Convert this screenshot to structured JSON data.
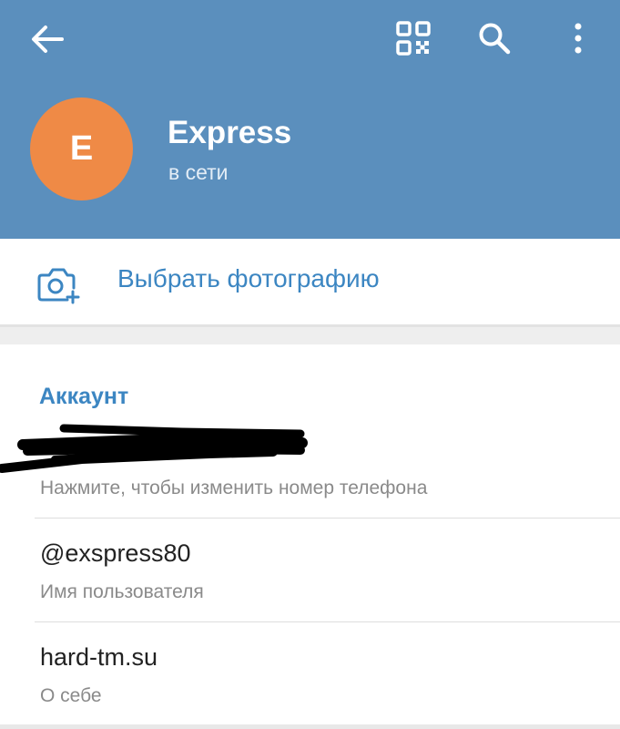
{
  "header": {
    "back_icon": "arrow-left-icon",
    "qr_icon": "qr-code-icon",
    "search_icon": "search-icon",
    "more_icon": "more-vertical-icon",
    "background_color": "#5b8fbd"
  },
  "profile": {
    "avatar_letter": "E",
    "avatar_color": "#ef8a46",
    "name": "Express",
    "status": "в сети"
  },
  "photo": {
    "icon": "camera-add-icon",
    "label": "Выбрать фотографию"
  },
  "account": {
    "title": "Аккаунт",
    "phone_hint": "Нажмите, чтобы изменить номер телефона",
    "username": "@exspress80",
    "username_label": "Имя пользователя",
    "bio": "hard-tm.su",
    "bio_label": "О себе"
  },
  "colors": {
    "accent": "#3c86c2"
  }
}
